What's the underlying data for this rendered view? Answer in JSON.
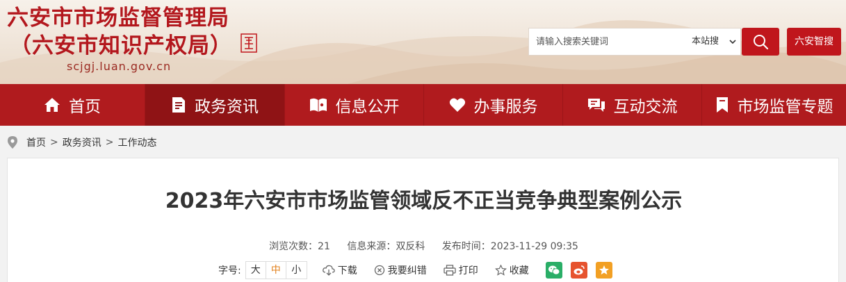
{
  "header": {
    "title_line1": "六安市市场监督管理局",
    "title_line2": "（六安市知识产权局）",
    "domain": "scjgj.luan.gov.cn",
    "search_placeholder": "请输入搜索关键词",
    "search_scope": "本站搜",
    "la_search_label": "六安智搜"
  },
  "nav": [
    {
      "label": "首页",
      "icon": "home-icon"
    },
    {
      "label": "政务资讯",
      "icon": "document-icon"
    },
    {
      "label": "信息公开",
      "icon": "open-book-icon"
    },
    {
      "label": "办事服务",
      "icon": "heart-icon"
    },
    {
      "label": "互动交流",
      "icon": "chat-icon"
    },
    {
      "label": "市场监管专题",
      "icon": "bookmark-icon"
    }
  ],
  "breadcrumb": [
    "首页",
    "政务资讯",
    "工作动态"
  ],
  "article": {
    "title": "2023年六安市市场监管领域反不正当竞争典型案例公示",
    "views": "浏览次数：21",
    "source": "信息来源：双反科",
    "published": "发布时间：2023-11-29 09:35",
    "font_size_label": "字号:",
    "font_sizes": [
      "大",
      "中",
      "小"
    ],
    "download": "下载",
    "report_error": "我要纠错",
    "print": "打印",
    "favorite": "收藏"
  },
  "colors": {
    "brand_red": "#b01b1e",
    "title_red": "#b3171d",
    "accent_orange": "#e2801c",
    "wechat": "#2aae67",
    "weibo": "#e6532e",
    "qzone": "#f2a024"
  }
}
